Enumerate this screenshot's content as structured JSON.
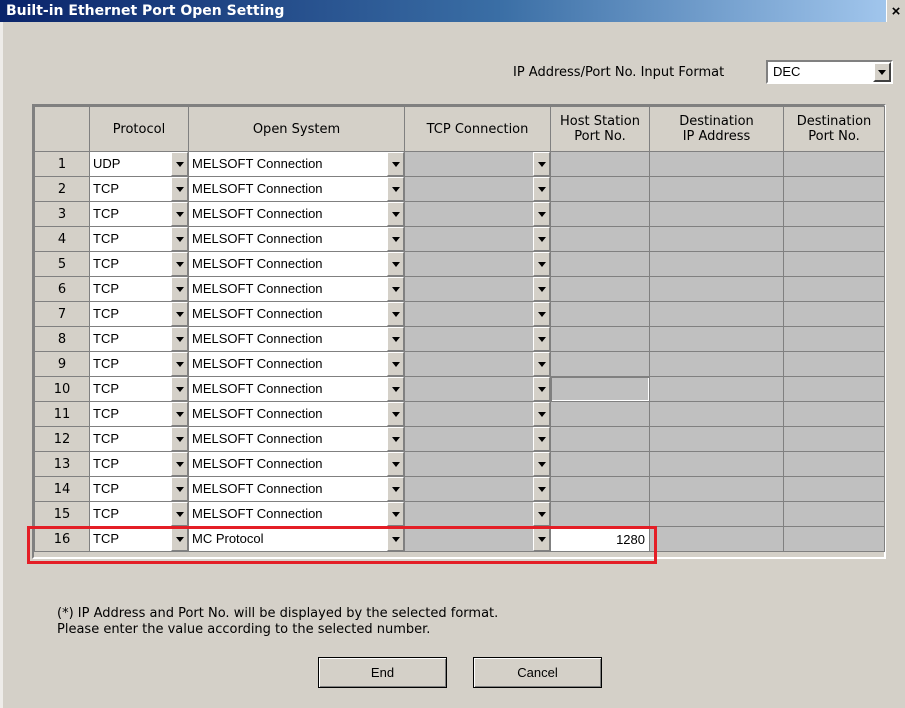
{
  "window": {
    "title": "Built-in Ethernet Port Open Setting",
    "close_glyph": "×"
  },
  "format": {
    "label": "IP Address/Port No. Input Format",
    "value": "DEC"
  },
  "table": {
    "headers": {
      "num": "",
      "protocol": "Protocol",
      "open_system": "Open System",
      "tcp_connection": "TCP Connection",
      "host_port": [
        "Host Station",
        "Port No."
      ],
      "dest_ip": [
        "Destination",
        "IP Address"
      ],
      "dest_port": [
        "Destination",
        "Port No."
      ]
    },
    "rows": [
      {
        "num": "1",
        "protocol": "UDP",
        "open_system": "MELSOFT Connection",
        "tcp_connection": "",
        "host_port": ""
      },
      {
        "num": "2",
        "protocol": "TCP",
        "open_system": "MELSOFT Connection",
        "tcp_connection": "",
        "host_port": ""
      },
      {
        "num": "3",
        "protocol": "TCP",
        "open_system": "MELSOFT Connection",
        "tcp_connection": "",
        "host_port": ""
      },
      {
        "num": "4",
        "protocol": "TCP",
        "open_system": "MELSOFT Connection",
        "tcp_connection": "",
        "host_port": ""
      },
      {
        "num": "5",
        "protocol": "TCP",
        "open_system": "MELSOFT Connection",
        "tcp_connection": "",
        "host_port": ""
      },
      {
        "num": "6",
        "protocol": "TCP",
        "open_system": "MELSOFT Connection",
        "tcp_connection": "",
        "host_port": ""
      },
      {
        "num": "7",
        "protocol": "TCP",
        "open_system": "MELSOFT Connection",
        "tcp_connection": "",
        "host_port": ""
      },
      {
        "num": "8",
        "protocol": "TCP",
        "open_system": "MELSOFT Connection",
        "tcp_connection": "",
        "host_port": ""
      },
      {
        "num": "9",
        "protocol": "TCP",
        "open_system": "MELSOFT Connection",
        "tcp_connection": "",
        "host_port": ""
      },
      {
        "num": "10",
        "protocol": "TCP",
        "open_system": "MELSOFT Connection",
        "tcp_connection": "",
        "host_port": ""
      },
      {
        "num": "11",
        "protocol": "TCP",
        "open_system": "MELSOFT Connection",
        "tcp_connection": "",
        "host_port": ""
      },
      {
        "num": "12",
        "protocol": "TCP",
        "open_system": "MELSOFT Connection",
        "tcp_connection": "",
        "host_port": ""
      },
      {
        "num": "13",
        "protocol": "TCP",
        "open_system": "MELSOFT Connection",
        "tcp_connection": "",
        "host_port": ""
      },
      {
        "num": "14",
        "protocol": "TCP",
        "open_system": "MELSOFT Connection",
        "tcp_connection": "",
        "host_port": ""
      },
      {
        "num": "15",
        "protocol": "TCP",
        "open_system": "MELSOFT Connection",
        "tcp_connection": "",
        "host_port": ""
      },
      {
        "num": "16",
        "protocol": "TCP",
        "open_system": "MC Protocol",
        "tcp_connection": "",
        "host_port": "1280"
      }
    ]
  },
  "note": {
    "line1": "(*) IP Address and Port No. will be displayed by the selected format.",
    "line2": "Please enter the value according to the selected number."
  },
  "buttons": {
    "end": "End",
    "cancel": "Cancel"
  },
  "colors": {
    "highlight": "#e41e26",
    "title_bar": "#0a246a"
  }
}
